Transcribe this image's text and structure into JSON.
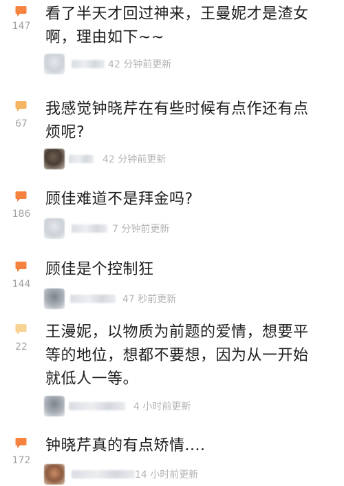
{
  "colors": {
    "bubble_orange": "#f5823f",
    "bubble_amber": "#f5b462",
    "bubble_light": "#f7d293",
    "count_text": "#a3a3a3",
    "time_text": "#b3b3b3",
    "comment_text": "#1e1e1e"
  },
  "posts": [
    {
      "icon": "comment-bubble-icon",
      "count": "147",
      "text_lines": [
        "看了半天才回过神来，王曼妮才是渣女",
        "啊，理由如下~~"
      ],
      "time": "42 分钟前更新"
    },
    {
      "icon": "comment-bubble-icon",
      "count": "67",
      "text_lines": [
        "我感觉钟晓芹在有些时候有点作还有点",
        "烦呢?"
      ],
      "time": "42 分钟前更新"
    },
    {
      "icon": "comment-bubble-icon",
      "count": "186",
      "text_lines": [
        "顾佳难道不是拜金吗?"
      ],
      "time": "7 分钟前更新"
    },
    {
      "icon": "comment-bubble-icon",
      "count": "144",
      "text_lines": [
        "顾佳是个控制狂"
      ],
      "time": "47 秒前更新"
    },
    {
      "icon": "comment-bubble-icon",
      "count": "22",
      "text_lines": [
        "王漫妮，以物质为前题的爱情，想要平",
        "等的地位，想都不要想，因为从一开始",
        "就低人一等。"
      ],
      "time": "4 小时前更新"
    },
    {
      "icon": "comment-bubble-icon",
      "count": "172",
      "text_lines": [
        "钟晓芹真的有点矫情...."
      ],
      "time": "14 小时前更新"
    }
  ]
}
